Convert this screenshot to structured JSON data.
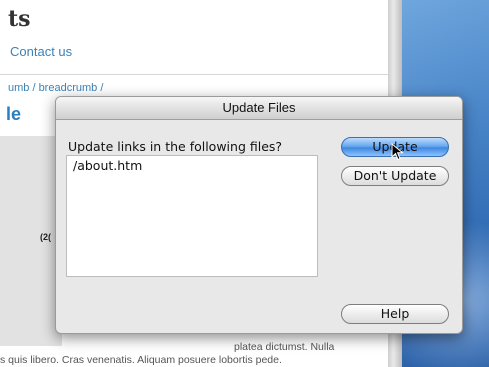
{
  "page": {
    "title": "ts",
    "contact_link": "Contact us",
    "breadcrumb": "umb / breadcrumb /",
    "section_heading": "le",
    "grey_block_label": "(2(",
    "body_line1": "platea dictumst. Nulla",
    "body_line2": "s quis libero. Cras venenatis. Aliquam posuere lobortis pede."
  },
  "dialog": {
    "title": "Update Files",
    "prompt": "Update links in the following files?",
    "files": [
      "/about.htm"
    ],
    "buttons": {
      "update": "Update",
      "dont_update": "Don't Update",
      "help": "Help"
    }
  },
  "colors": {
    "link": "#3a82b8",
    "heading": "#2a7fc0",
    "default_button": "#3f88e2",
    "desktop": "#4a86c9"
  }
}
